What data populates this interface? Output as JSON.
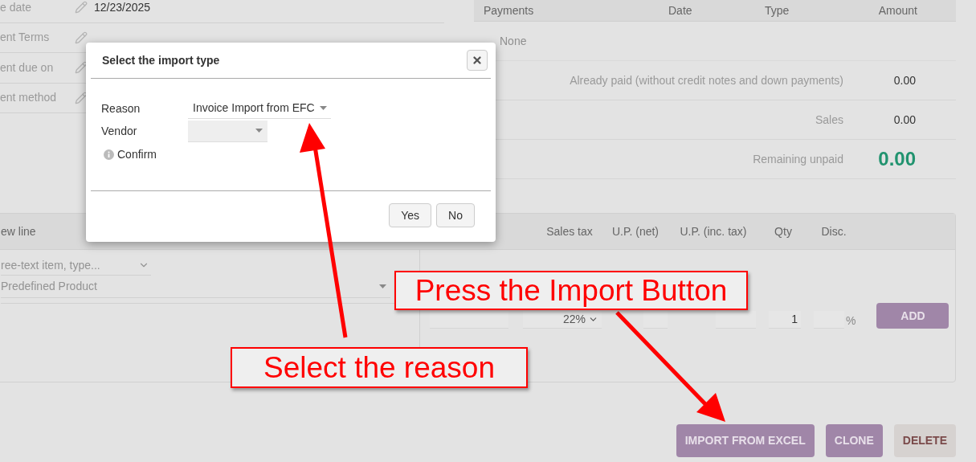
{
  "invoice_fields": [
    {
      "label": "e date",
      "value": "12/23/2025"
    },
    {
      "label": "ent Terms"
    },
    {
      "label": "ent due on"
    },
    {
      "label": "ent method"
    }
  ],
  "payments": {
    "columns": [
      "Payments",
      "Date",
      "Type",
      "Amount"
    ],
    "empty_text": "None",
    "summary": [
      {
        "label": "Already paid (without credit notes and down payments)",
        "value": "0.00",
        "kind": "normal"
      },
      {
        "label": "Sales",
        "value": "0.00",
        "kind": "normal"
      },
      {
        "label": "Remaining unpaid",
        "value": "0.00",
        "kind": "total"
      }
    ]
  },
  "new_line": {
    "title": "ew line",
    "free_text_placeholder": "ree-text item, type...",
    "product_placeholder": "Predefined Product"
  },
  "line_columns": [
    "Sales tax",
    "U.P. (net)",
    "U.P. (inc. tax)",
    "Qty",
    "Disc."
  ],
  "line_inputs": {
    "sales_tax": "22%",
    "qty": "1",
    "discount_unit": "%",
    "add_button": "ADD"
  },
  "actions": [
    {
      "label": "IMPORT FROM EXCEL",
      "kind": "primary"
    },
    {
      "label": "CLONE",
      "kind": "primary"
    },
    {
      "label": "DELETE",
      "kind": "secondary"
    }
  ],
  "dialog": {
    "title": "Select the import type",
    "reason_label": "Reason",
    "reason_value": "Invoice Import from EFC",
    "vendor_label": "Vendor",
    "confirm_label": "Confirm",
    "buttons": [
      "Yes",
      "No"
    ]
  },
  "annotations": [
    "Press the Import Button",
    "Select the reason"
  ]
}
